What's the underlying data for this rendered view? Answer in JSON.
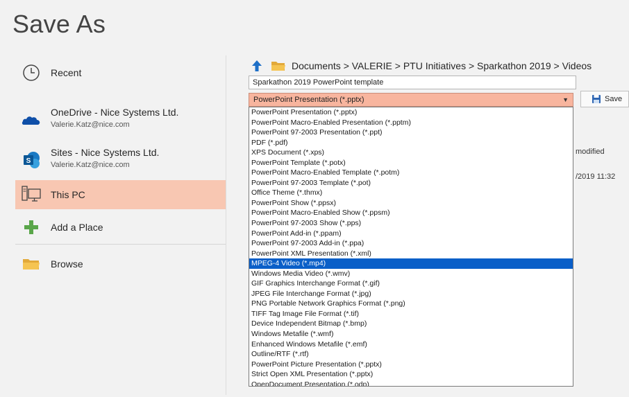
{
  "window": {
    "title": "Save As"
  },
  "nav": {
    "recent": {
      "label": "Recent"
    },
    "onedrive": {
      "label": "OneDrive - Nice Systems Ltd.",
      "sub": "Valerie.Katz@nice.com"
    },
    "sites": {
      "label": "Sites - Nice Systems Ltd.",
      "sub": "Valerie.Katz@nice.com"
    },
    "thispc": {
      "label": "This PC"
    },
    "addplace": {
      "label": "Add a Place"
    },
    "browse": {
      "label": "Browse"
    }
  },
  "location": {
    "breadcrumb": "Documents > VALERIE > PTU Initiatives > Sparkathon 2019 > Videos"
  },
  "file": {
    "name": "Sparkathon 2019 PowerPoint template",
    "type_selected": "PowerPoint Presentation (*.pptx)"
  },
  "file_types": [
    "PowerPoint Presentation (*.pptx)",
    "PowerPoint Macro-Enabled Presentation (*.pptm)",
    "PowerPoint 97-2003 Presentation (*.ppt)",
    "PDF (*.pdf)",
    "XPS Document (*.xps)",
    "PowerPoint Template (*.potx)",
    "PowerPoint Macro-Enabled Template (*.potm)",
    "PowerPoint 97-2003 Template (*.pot)",
    "Office Theme (*.thmx)",
    "PowerPoint Show (*.ppsx)",
    "PowerPoint Macro-Enabled Show (*.ppsm)",
    "PowerPoint 97-2003 Show (*.pps)",
    "PowerPoint Add-in (*.ppam)",
    "PowerPoint 97-2003 Add-in (*.ppa)",
    "PowerPoint XML Presentation (*.xml)",
    "MPEG-4 Video (*.mp4)",
    "Windows Media Video (*.wmv)",
    "GIF Graphics Interchange Format (*.gif)",
    "JPEG File Interchange Format (*.jpg)",
    "PNG Portable Network Graphics Format (*.png)",
    "TIFF Tag Image File Format (*.tif)",
    "Device Independent Bitmap (*.bmp)",
    "Windows Metafile (*.wmf)",
    "Enhanced Windows Metafile (*.emf)",
    "Outline/RTF (*.rtf)",
    "PowerPoint Picture Presentation (*.pptx)",
    "Strict Open XML Presentation (*.pptx)",
    "OpenDocument Presentation (*.odp)"
  ],
  "highlighted_type_index": 15,
  "actions": {
    "save_label": "Save"
  },
  "file_list": {
    "col_modified": "modified",
    "row_date": "/2019 11:32"
  },
  "colors": {
    "accent_selected_nav": "#f8c7b2",
    "type_select_bg": "#f8b59e",
    "list_highlight": "#0a5fc8",
    "up_arrow": "#1e6fc7",
    "folder": "#f2c14e"
  },
  "icons": {
    "recent": "clock-icon",
    "onedrive": "cloud-icon",
    "sites": "sharepoint-icon",
    "thispc": "computer-icon",
    "addplace": "plus-icon",
    "browse": "folder-icon",
    "up": "up-arrow-icon",
    "path_folder": "folder-icon",
    "save": "save-icon"
  }
}
